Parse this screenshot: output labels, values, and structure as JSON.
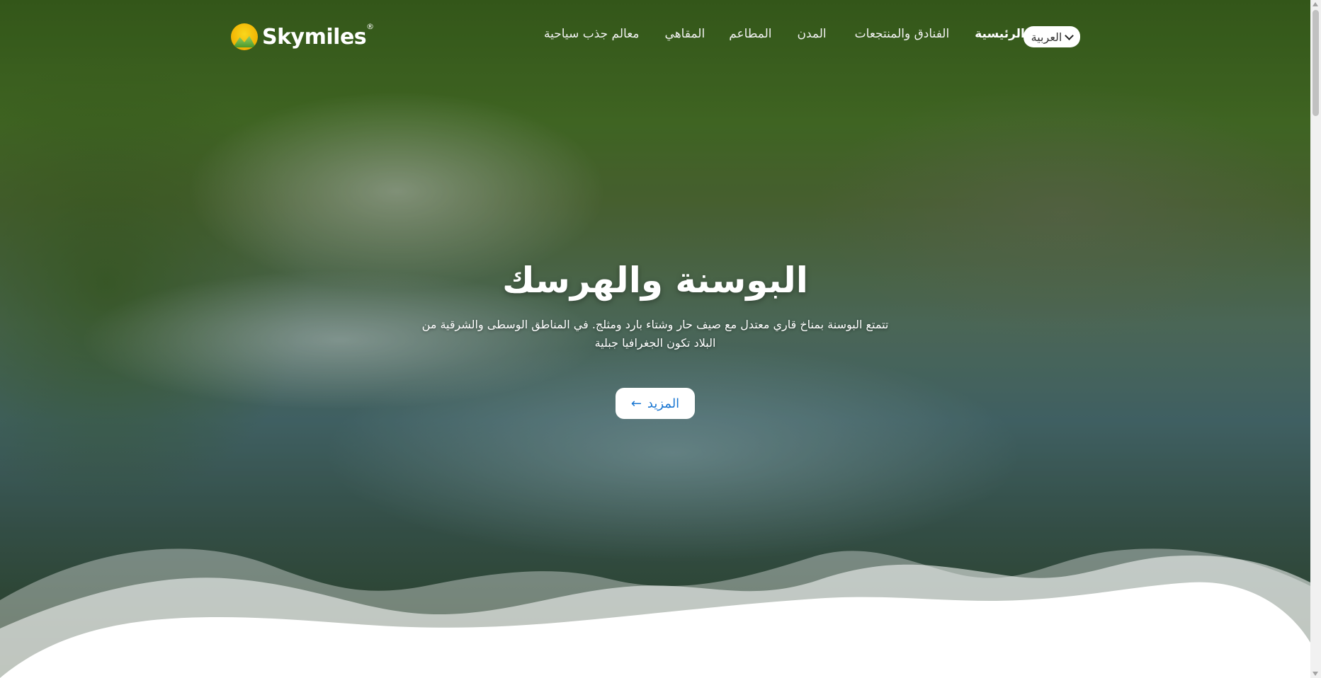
{
  "brand": {
    "name": "Skymiles",
    "mark": "®"
  },
  "language": {
    "selected": "العربية"
  },
  "nav": {
    "items": [
      {
        "label": "الرئيسية",
        "active": true
      },
      {
        "label": "الفنادق والمنتجعات",
        "active": false
      },
      {
        "label": "المدن",
        "active": false
      },
      {
        "label": "المطاعم",
        "active": false
      },
      {
        "label": "المقاهي",
        "active": false
      },
      {
        "label": "معالم جذب سياحية",
        "active": false
      }
    ]
  },
  "hero": {
    "title": "البوسنة والهرسك",
    "description": "تتمتع البوسنة بمناخ قاري معتدل مع صيف حار وشتاء بارد ومثلج. في المناطق الوسطى والشرقية من البلاد تكون الجغرافيا جبلية",
    "button_label": "المزيد",
    "button_icon": "arrow-left-icon"
  },
  "colors": {
    "accent": "#1976d2",
    "nav_text": "#ffffff",
    "button_bg": "#ffffff"
  }
}
